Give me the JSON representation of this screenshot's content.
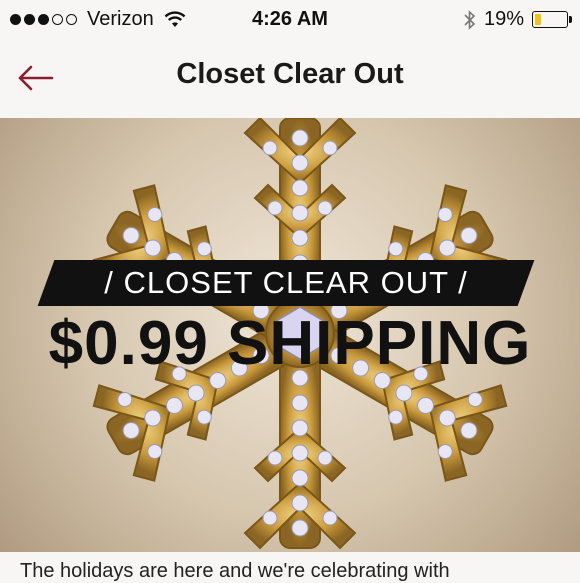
{
  "status_bar": {
    "carrier": "Verizon",
    "time": "4:26 AM",
    "battery_percent": "19%",
    "battery_level": 0.19,
    "signal_bars_filled": 3,
    "signal_bars_total": 5
  },
  "nav": {
    "title": "Closet Clear Out",
    "back_icon": "back-arrow-icon",
    "accent_color": "#8b1d2c"
  },
  "hero": {
    "banner_text": "/  CLOSET CLEAR OUT  /",
    "promo_text": "$0.99 SHIPPING"
  },
  "description": {
    "text": "The holidays are here and we're celebrating with"
  }
}
